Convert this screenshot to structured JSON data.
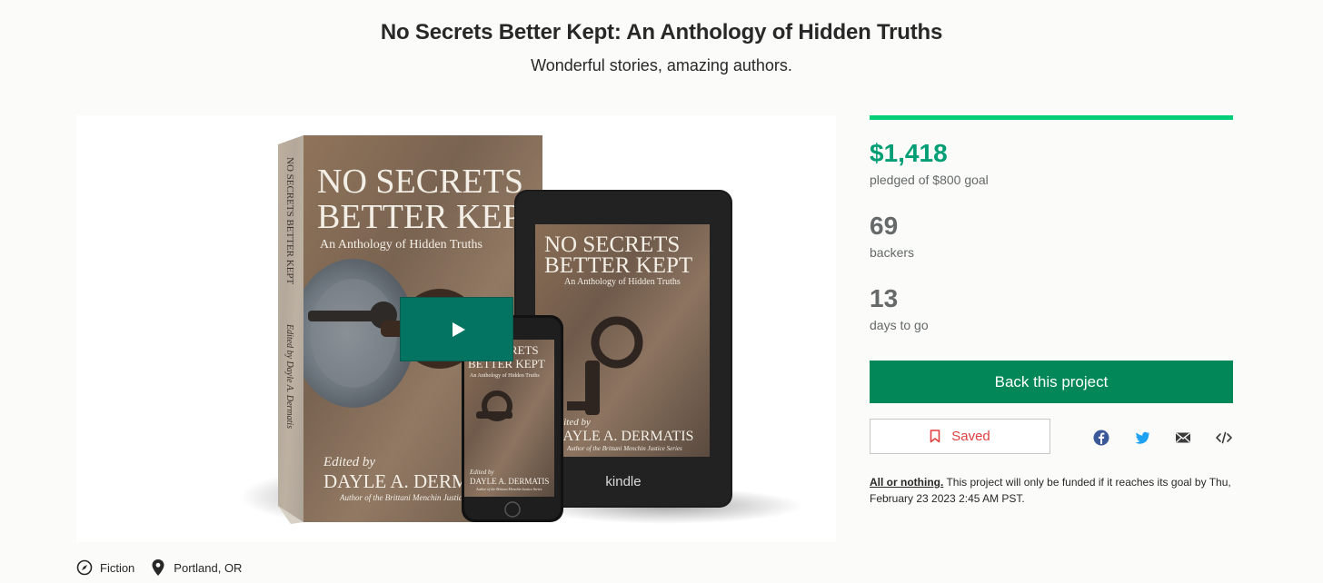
{
  "project": {
    "title": "No Secrets Better Kept: An Anthology of Hidden Truths",
    "subtitle": "Wonderful stories, amazing authors."
  },
  "media": {
    "paperback": {
      "title_line1": "NO SECRETS",
      "title_line2": "BETTER KEPT",
      "tagline": "An Anthology of Hidden Truths",
      "edited_by": "Edited by",
      "editor": "DAYLE A. DERMATIS",
      "author_note": "Author of the Brittani Menchin Justice Series",
      "spine_title": "NO SECRETS BETTER KEPT",
      "spine_editor": "Edited by Dayle A. Dermatis"
    },
    "kindle": {
      "title_line1": "NO SECRETS",
      "title_line2": "BETTER KEPT",
      "tagline": "An Anthology of Hidden Truths",
      "edited_by": "Edited by",
      "editor": "DAYLE A. DERMATIS",
      "author_note": "Author of the Brittani Menchin Justice Series",
      "brand": "kindle"
    },
    "phone": {
      "title_line1": "NO SECRETS",
      "title_line2": "BETTER KEPT",
      "tagline": "An Anthology of Hidden Truths",
      "edited_by": "Edited by",
      "editor": "DAYLE A. DERMATIS",
      "author_note": "Author of the Brittani Menchin Justice Series"
    },
    "play_icon": "play-icon"
  },
  "stats": {
    "funded_fraction": 1.0,
    "pledged_amount": "$1,418",
    "pledged_label": "pledged of $800 goal",
    "backers_count": "69",
    "backers_label": "backers",
    "days_count": "13",
    "days_label": "days to go"
  },
  "actions": {
    "back_label": "Back this project",
    "saved_label": "Saved",
    "saved_icon": "bookmark-icon",
    "share_icons": [
      "facebook-icon",
      "twitter-icon",
      "email-icon",
      "embed-icon"
    ]
  },
  "funding_note": {
    "link": "All or nothing.",
    "text": " This project will only be funded if it reaches its goal by Thu, February 23 2023 2:45 AM PST."
  },
  "meta": {
    "category": "Fiction",
    "location": "Portland, OR"
  },
  "colors": {
    "accent_green": "#009e74",
    "button_green": "#028858",
    "progress_green": "#05ce78",
    "saved_red": "#e03f3f",
    "facebook_blue": "#3b5998",
    "twitter_blue": "#1da1f2"
  }
}
